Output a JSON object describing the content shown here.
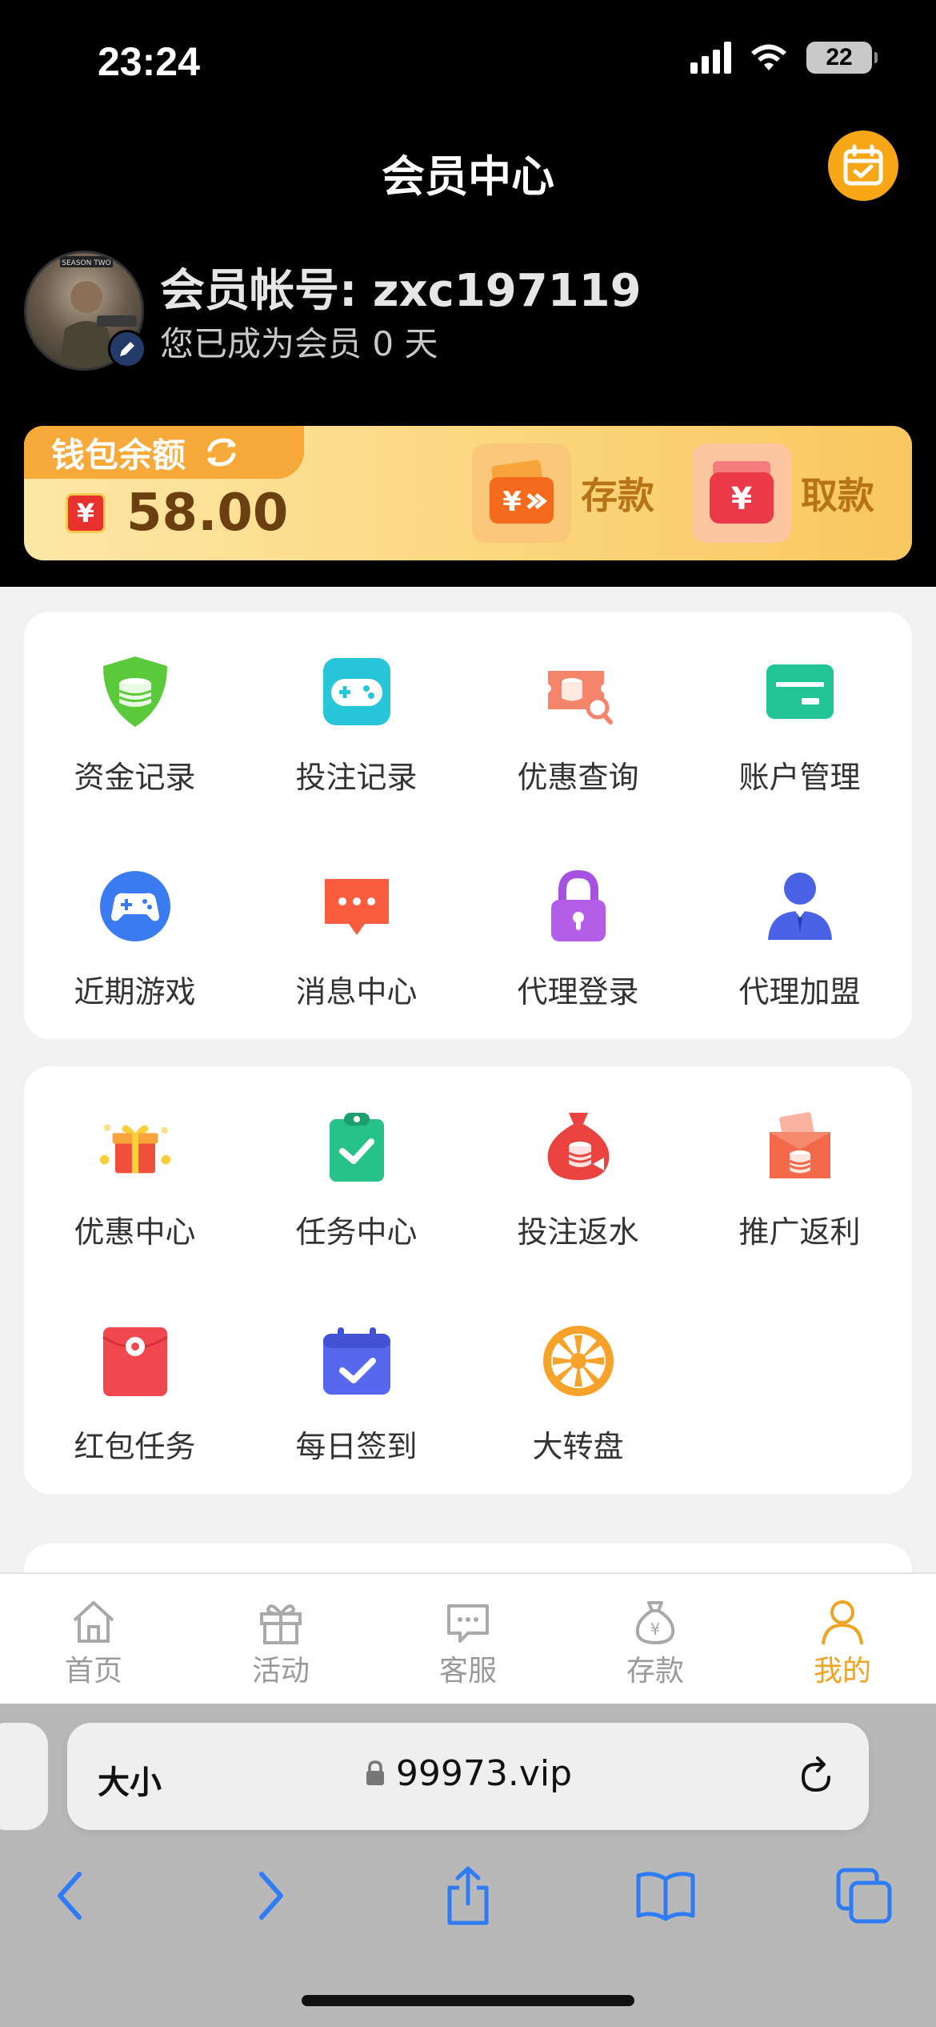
{
  "status": {
    "time": "23:24",
    "battery": "22"
  },
  "header": {
    "title": "会员中心"
  },
  "profile": {
    "account_label": "会员帐号:",
    "account_id": "zxc197119",
    "member_prefix": "您已成为会员",
    "member_days": "0",
    "member_suffix": "天",
    "avatar_caption": "SEASON TWO"
  },
  "wallet": {
    "label": "钱包余额",
    "currency": "¥",
    "amount": "58.00",
    "deposit_label": "存款",
    "withdraw_label": "取款"
  },
  "menu1": [
    {
      "label": "资金记录",
      "icon": "shield-coins-icon"
    },
    {
      "label": "投注记录",
      "icon": "gamepad-icon"
    },
    {
      "label": "优惠查询",
      "icon": "coupon-search-icon"
    },
    {
      "label": "账户管理",
      "icon": "card-icon"
    },
    {
      "label": "近期游戏",
      "icon": "controller-icon"
    },
    {
      "label": "消息中心",
      "icon": "message-icon"
    },
    {
      "label": "代理登录",
      "icon": "lock-icon"
    },
    {
      "label": "代理加盟",
      "icon": "agent-icon"
    }
  ],
  "menu2": [
    {
      "label": "优惠中心",
      "icon": "gift-icon"
    },
    {
      "label": "任务中心",
      "icon": "clipboard-check-icon"
    },
    {
      "label": "投注返水",
      "icon": "money-bag-icon"
    },
    {
      "label": "推广返利",
      "icon": "wallet-coins-icon"
    },
    {
      "label": "红包任务",
      "icon": "red-envelope-icon"
    },
    {
      "label": "每日签到",
      "icon": "calendar-check-icon"
    },
    {
      "label": "大转盘",
      "icon": "wheel-icon"
    }
  ],
  "tabbar": [
    {
      "label": "首页",
      "icon": "home-icon"
    },
    {
      "label": "活动",
      "icon": "gift-outline-icon"
    },
    {
      "label": "客服",
      "icon": "chat-icon"
    },
    {
      "label": "存款",
      "icon": "money-bag-outline-icon"
    },
    {
      "label": "我的",
      "icon": "user-icon",
      "active": true
    }
  ],
  "browser": {
    "text_size": "大小",
    "url": "99973.vip"
  },
  "colors": {
    "accent": "#efa323",
    "wallet_tab": "#f7a93a",
    "header_bg": "#000000"
  }
}
